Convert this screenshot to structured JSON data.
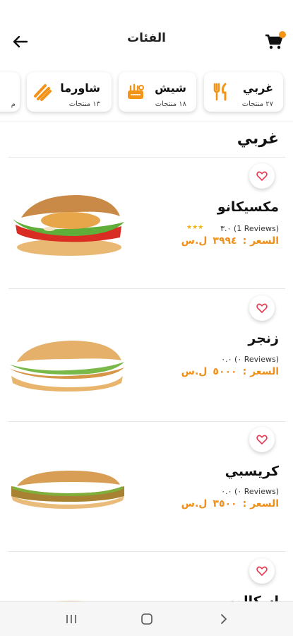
{
  "header": {
    "title": "الفئات",
    "back_icon": "arrow-left-icon",
    "cart_icon": "cart-icon",
    "accent": "#f39318"
  },
  "categories": [
    {
      "name": "غربي",
      "count": "٢٧ منتجات",
      "icon": "fork-knife-icon"
    },
    {
      "name": "شيش",
      "count": "١٨ منتجات",
      "icon": "grill-icon"
    },
    {
      "name": "شاورما",
      "count": "١٣ منتجات",
      "icon": "shawarma-icon"
    },
    {
      "name": "",
      "count": "م",
      "icon": ""
    }
  ],
  "section": {
    "title": "غربي"
  },
  "products": [
    {
      "name": "مكسيكانو",
      "reviews": "٣.٠ (1 Reviews)",
      "rating": 3,
      "price_label": "السعر :",
      "price": "٣٩٩٤",
      "currency": "ل.س"
    },
    {
      "name": "زنجر",
      "reviews": "٠.٠ (٠ Reviews)",
      "rating": 0,
      "price_label": "السعر :",
      "price": "٥٠٠٠",
      "currency": "ل.س"
    },
    {
      "name": "كريسبي",
      "reviews": "٠.٠ (٠ Reviews)",
      "rating": 0,
      "price_label": "السعر :",
      "price": "٣٥٠٠",
      "currency": "ل.س"
    },
    {
      "name": "اسكالوب",
      "reviews": "",
      "rating": 0,
      "price_label": "",
      "price": "",
      "currency": ""
    }
  ],
  "system_nav": {
    "recents_icon": "recents-icon",
    "home_icon": "home-icon",
    "back_icon": "chevron-back-icon"
  }
}
